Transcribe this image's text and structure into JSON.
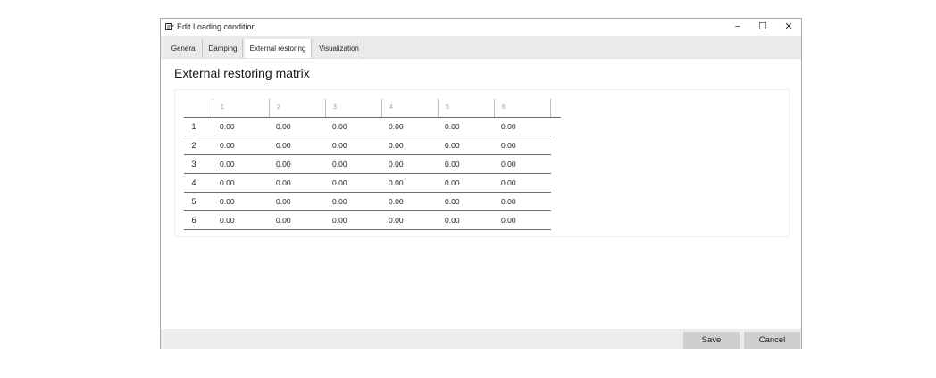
{
  "window": {
    "title": "Edit Loading condition",
    "controls": {
      "minimize": "−",
      "maximize": "☐",
      "close": "✕"
    }
  },
  "tabs": [
    {
      "label": "General",
      "active": false
    },
    {
      "label": "Damping",
      "active": false
    },
    {
      "label": "External restoring",
      "active": true
    },
    {
      "label": "Visualization",
      "active": false
    }
  ],
  "heading": "External restoring matrix",
  "matrix": {
    "columns": [
      "1",
      "2",
      "3",
      "4",
      "5",
      "6"
    ],
    "rows": [
      {
        "label": "1",
        "values": [
          "0.00",
          "0.00",
          "0.00",
          "0.00",
          "0.00",
          "0.00"
        ]
      },
      {
        "label": "2",
        "values": [
          "0.00",
          "0.00",
          "0.00",
          "0.00",
          "0.00",
          "0.00"
        ]
      },
      {
        "label": "3",
        "values": [
          "0.00",
          "0.00",
          "0.00",
          "0.00",
          "0.00",
          "0.00"
        ]
      },
      {
        "label": "4",
        "values": [
          "0.00",
          "0.00",
          "0.00",
          "0.00",
          "0.00",
          "0.00"
        ]
      },
      {
        "label": "5",
        "values": [
          "0.00",
          "0.00",
          "0.00",
          "0.00",
          "0.00",
          "0.00"
        ]
      },
      {
        "label": "6",
        "values": [
          "0.00",
          "0.00",
          "0.00",
          "0.00",
          "0.00",
          "0.00"
        ]
      }
    ]
  },
  "actions": {
    "save": "Save",
    "cancel": "Cancel"
  }
}
